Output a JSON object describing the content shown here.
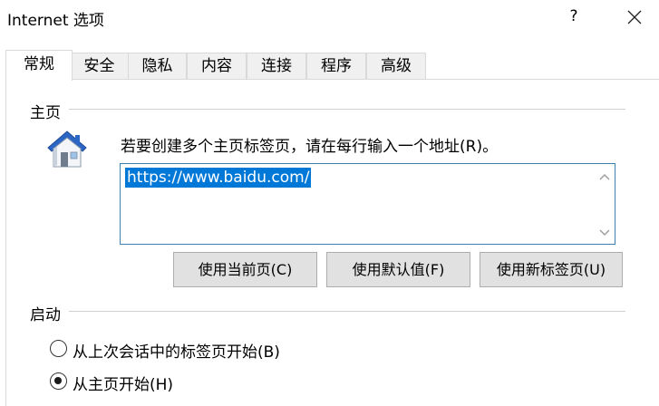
{
  "window": {
    "title": "Internet 选项",
    "help_label": "?"
  },
  "tabs": [
    {
      "label": "常规",
      "active": true
    },
    {
      "label": "安全",
      "active": false
    },
    {
      "label": "隐私",
      "active": false
    },
    {
      "label": "内容",
      "active": false
    },
    {
      "label": "连接",
      "active": false
    },
    {
      "label": "程序",
      "active": false
    },
    {
      "label": "高级",
      "active": false
    }
  ],
  "home_page": {
    "group_label": "主页",
    "description": "若要创建多个主页标签页，请在每行输入一个地址(R)。",
    "url": "https://www.baidu.com/",
    "buttons": {
      "use_current": "使用当前页(C)",
      "use_default": "使用默认值(F)",
      "use_new_tab": "使用新标签页(U)"
    }
  },
  "startup": {
    "group_label": "启动",
    "options": [
      {
        "label": "从上次会话中的标签页开始(B)",
        "selected": false
      },
      {
        "label": "从主页开始(H)",
        "selected": true
      }
    ]
  },
  "colors": {
    "selection": "#0078d7",
    "button_face": "#e1e1e1",
    "input_border": "#3c7fb1"
  }
}
